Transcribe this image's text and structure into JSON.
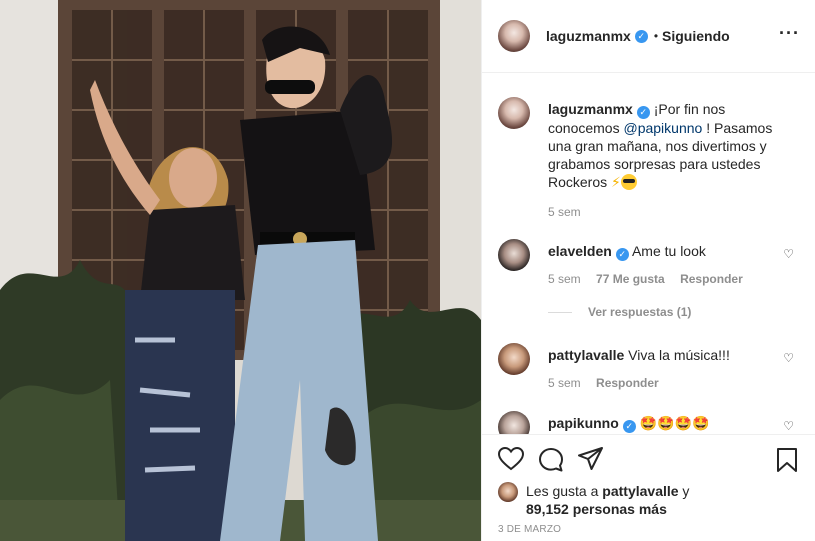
{
  "post": {
    "username": "laguzmanmx",
    "following_label": "Siguiendo",
    "more_icon": "ellipsis-icon"
  },
  "caption": {
    "username": "laguzmanmx",
    "text_before": "¡Por fin nos conocemos ",
    "mention": "@papikunno",
    "text_after": " ! Pasamos una gran mañana, nos divertimos y grabamos sorpresas para ustedes Rockeros",
    "time": "5 sem"
  },
  "comments": [
    {
      "username": "elavelden",
      "text": "Ame tu look",
      "time": "5 sem",
      "likes": "77 Me gusta",
      "reply": "Responder",
      "view_replies": "Ver respuestas (1)"
    },
    {
      "username": "pattylavalle",
      "text": "Viva la música!!!",
      "time": "5 sem",
      "reply": "Responder"
    },
    {
      "username": "papikunno",
      "text": "🤩🤩🤩🤩"
    }
  ],
  "likes": {
    "prefix": "Les gusta a ",
    "user": "pattylavalle",
    "suffix": " y",
    "count": "89,152 personas más"
  },
  "date": "3 DE MARZO",
  "colors": {
    "verified": "#3897f0",
    "meta": "#8e8e8e",
    "mention": "#00376b"
  }
}
